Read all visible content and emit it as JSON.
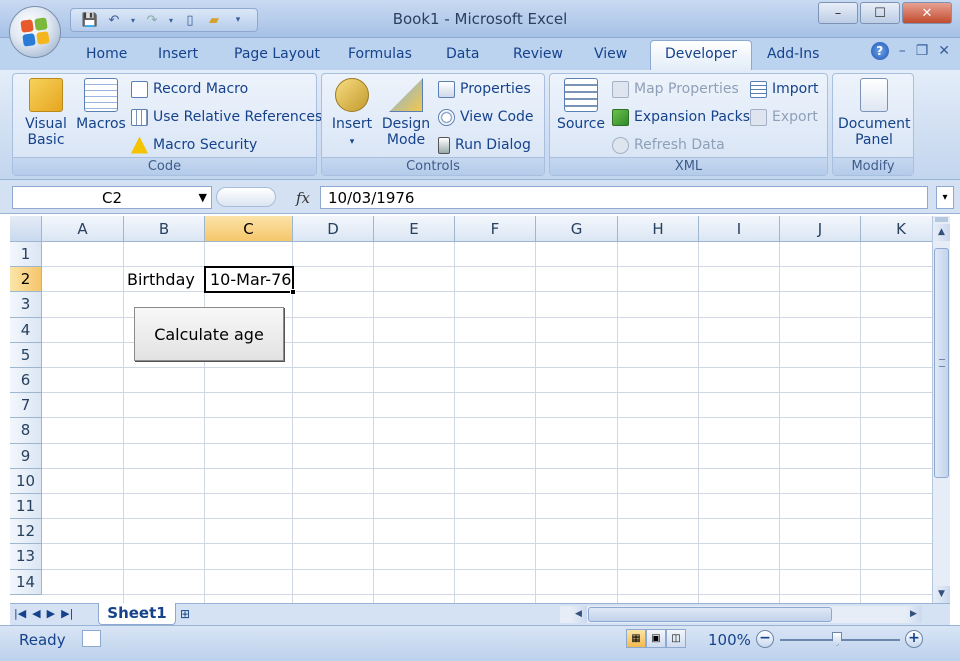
{
  "window": {
    "title": "Book1 - Microsoft Excel",
    "minimize": "–",
    "maximize": "☐",
    "close": "✕"
  },
  "tabs": [
    "Home",
    "Insert",
    "Page Layout",
    "Formulas",
    "Data",
    "Review",
    "View",
    "Developer",
    "Add-Ins"
  ],
  "active_tab": "Developer",
  "ribbon": {
    "code": {
      "label": "Code",
      "visual_basic": "Visual Basic",
      "macros": "Macros",
      "record_macro": "Record Macro",
      "relative_refs": "Use Relative References",
      "macro_security": "Macro Security"
    },
    "controls": {
      "label": "Controls",
      "insert": "Insert",
      "design_mode": "Design Mode",
      "properties": "Properties",
      "view_code": "View Code",
      "run_dialog": "Run Dialog"
    },
    "xml": {
      "label": "XML",
      "source": "Source",
      "map_properties": "Map Properties",
      "expansion_packs": "Expansion Packs",
      "refresh_data": "Refresh Data",
      "import": "Import",
      "export": "Export"
    },
    "modify": {
      "label": "Modify",
      "document_panel": "Document Panel"
    }
  },
  "formula_bar": {
    "name_box": "C2",
    "fx": "fx",
    "value": "10/03/1976"
  },
  "grid": {
    "columns": [
      "A",
      "B",
      "C",
      "D",
      "E",
      "F",
      "G",
      "H",
      "I",
      "J",
      "K"
    ],
    "rows": [
      "1",
      "2",
      "3",
      "4",
      "5",
      "6",
      "7",
      "8",
      "9",
      "10",
      "11",
      "12",
      "13",
      "14"
    ],
    "active_cell": "C2",
    "b2": "Birthday",
    "c2": "10-Mar-76",
    "button_label": "Calculate age"
  },
  "sheets": [
    "Sheet1"
  ],
  "status": {
    "ready": "Ready",
    "zoom": "100%"
  },
  "colors": {
    "accent": "#15428b",
    "active_header": "#f6c66b"
  }
}
